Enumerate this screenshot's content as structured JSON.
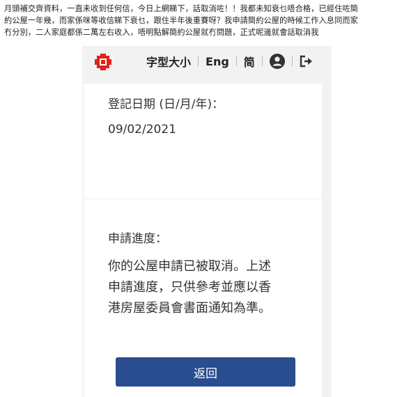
{
  "post": {
    "lines": [
      "月頭補交齊資料，一直未收到任何信，今日上網睇下，話取消咗！！我都未知衰乜唔合格，已經住咗簡",
      "約公屋一年幾，而家係咪等收信睇下衰乜，跟住半年後重賽呀？我申請簡約公屋的時候工作入息同而家",
      "冇分別，二人家庭都係二萬左右收入，唔明點解簡約公屋就冇問題，正式呢邊就會話取消我"
    ]
  },
  "header": {
    "font_size_label": "字型大小",
    "english_label": "Eng",
    "simplified_label": "简",
    "brand_color": "#e2231a"
  },
  "form": {
    "register_date_label": "登記日期 (日/月/年)：",
    "register_date_value": "09/02/2021",
    "progress_label": "申請進度：",
    "progress_text": "你的公屋申請已被取消。上述申請進度，只供參考並應以香港房屋委員會書面通知為準。",
    "back_button_label": "返回",
    "button_color": "#2a4d8f"
  }
}
